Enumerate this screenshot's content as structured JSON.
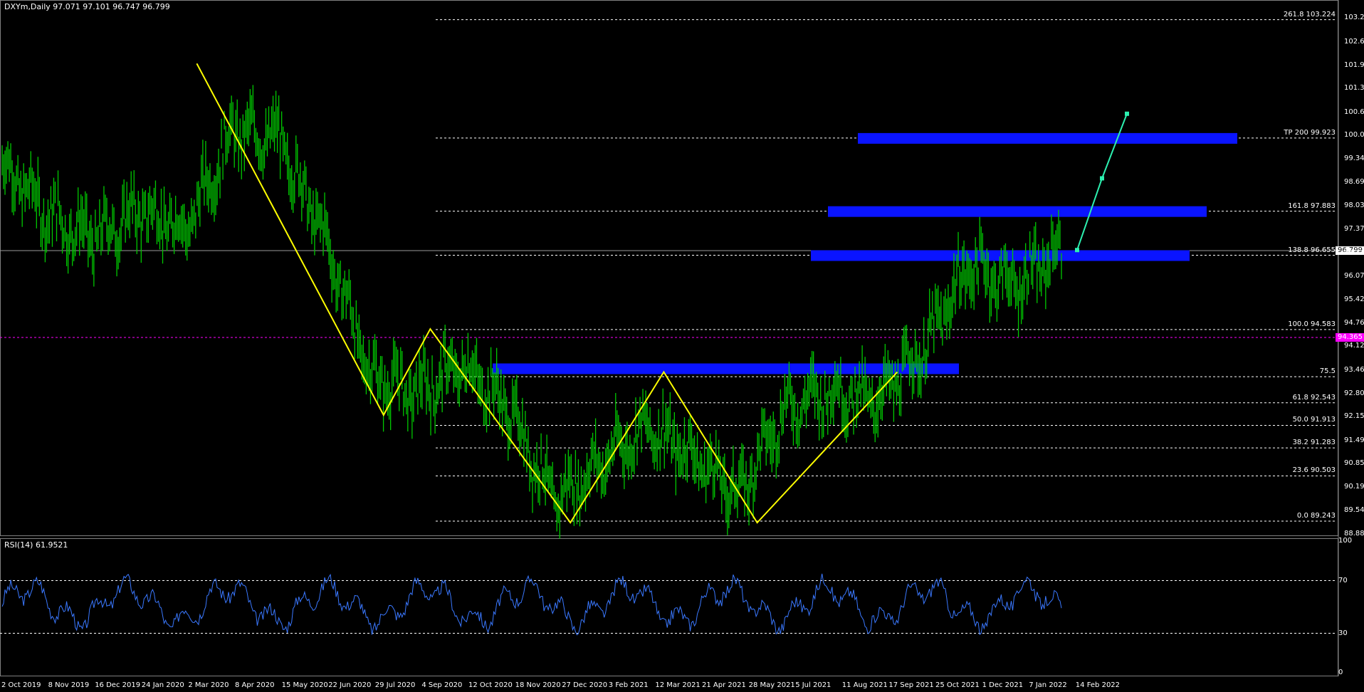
{
  "header": {
    "symbol_info": "DXYm,Daily  97.071 97.101 96.747 96.799"
  },
  "rsi_header": "RSI(14) 61.9521",
  "current_price_tag": "96.799",
  "pink_price_tag": "94.365",
  "colors": {
    "background": "#000000",
    "candles": "#00c800",
    "zigzag": "#ffff00",
    "projection": "#2cf0b0",
    "zones": "#0a14ff",
    "rsi_line": "#3a78ff",
    "grid_dotted": "#ffffff",
    "pink_line": "#ff00ff"
  },
  "y_axis": {
    "labels": [
      "103.275",
      "102.610",
      "101.950",
      "101.305",
      "100.645",
      "100.000",
      "99.340",
      "98.695",
      "98.035",
      "97.375",
      "96.715",
      "96.070",
      "95.425",
      "94.765",
      "94.120",
      "93.460",
      "92.800",
      "92.155",
      "91.495",
      "90.850",
      "90.190",
      "89.545",
      "88.885"
    ]
  },
  "fib_levels": [
    {
      "label": "261.8 103.224",
      "value": 103.224
    },
    {
      "label": "TP 200 99.923",
      "value": 99.923
    },
    {
      "label": "161.8 97.883",
      "value": 97.883
    },
    {
      "label": "138.8 96.655",
      "value": 96.655
    },
    {
      "label": "100.0 94.583",
      "value": 94.583
    },
    {
      "label": "75.5",
      "value": 93.27
    },
    {
      "label": "61.8 92.543",
      "value": 92.543
    },
    {
      "label": "50.0 91.913",
      "value": 91.913
    },
    {
      "label": "38.2 91.283",
      "value": 91.283
    },
    {
      "label": "23.6 90.503",
      "value": 90.503
    },
    {
      "label": "0.0 89.243",
      "value": 89.243
    }
  ],
  "x_axis": {
    "labels": [
      "2 Oct 2019",
      "8 Nov 2019",
      "16 Dec 2019",
      "24 Jan 2020",
      "2 Mar 2020",
      "8 Apr 2020",
      "15 May 2020",
      "22 Jun 2020",
      "29 Jul 2020",
      "4 Sep 2020",
      "12 Oct 2020",
      "18 Nov 2020",
      "27 Dec 2020",
      "3 Feb 2021",
      "12 Mar 2021",
      "21 Apr 2021",
      "28 May 2021",
      "5 Jul 2021",
      "11 Aug 2021",
      "17 Sep 2021",
      "25 Oct 2021",
      "1 Dec 2021",
      "7 Jan 2022",
      "14 Feb 2022"
    ]
  },
  "rsi_axis": {
    "labels": [
      "100",
      "70",
      "30",
      "0"
    ]
  },
  "chart_data": {
    "type": "line",
    "title": "DXYm,Daily",
    "series": [
      {
        "name": "DXYm",
        "x": [
          "2 Oct 2019",
          "8 Nov 2019",
          "16 Dec 2019",
          "24 Jan 2020",
          "2 Mar 2020",
          "8 Apr 2020",
          "15 May 2020",
          "22 Jun 2020",
          "29 Jul 2020",
          "4 Sep 2020",
          "12 Oct 2020",
          "18 Nov 2020",
          "27 Dec 2020",
          "3 Feb 2021",
          "12 Mar 2021",
          "21 Apr 2021",
          "28 May 2021",
          "5 Jul 2021",
          "11 Aug 2021",
          "17 Sep 2021",
          "25 Oct 2021",
          "1 Dec 2021",
          "7 Jan 2022",
          "14 Feb 2022"
        ],
        "values": [
          99.2,
          97.8,
          97.1,
          97.9,
          97.4,
          100.1,
          99.9,
          97.2,
          93.3,
          92.8,
          93.6,
          92.4,
          89.8,
          90.9,
          91.9,
          91.1,
          90.0,
          92.4,
          92.9,
          92.6,
          94.0,
          96.4,
          95.8,
          96.8
        ]
      }
    ],
    "zigzag": [
      {
        "x": "2 Mar 2020",
        "y": 102.0
      },
      {
        "x": "29 Jul 2020",
        "y": 92.2
      },
      {
        "x": "4 Sep 2020",
        "y": 94.6
      },
      {
        "x": "27 Dec 2020",
        "y": 89.2
      },
      {
        "x": "12 Mar 2021",
        "y": 93.4
      },
      {
        "x": "28 May 2021",
        "y": 89.2
      },
      {
        "x": "17 Sep 2021",
        "y": 93.4
      }
    ],
    "projection": [
      {
        "y": 96.8
      },
      {
        "y": 98.8
      },
      {
        "y": 100.6
      }
    ],
    "zones": [
      {
        "value": 99.923
      },
      {
        "value": 97.883
      },
      {
        "value": 96.655
      },
      {
        "value": 93.5
      }
    ],
    "rsi": {
      "name": "RSI(14)",
      "last": 61.9521,
      "levels": [
        70,
        30
      ],
      "ylim": [
        0,
        100
      ]
    },
    "ylim": [
      88.885,
      103.275
    ]
  }
}
